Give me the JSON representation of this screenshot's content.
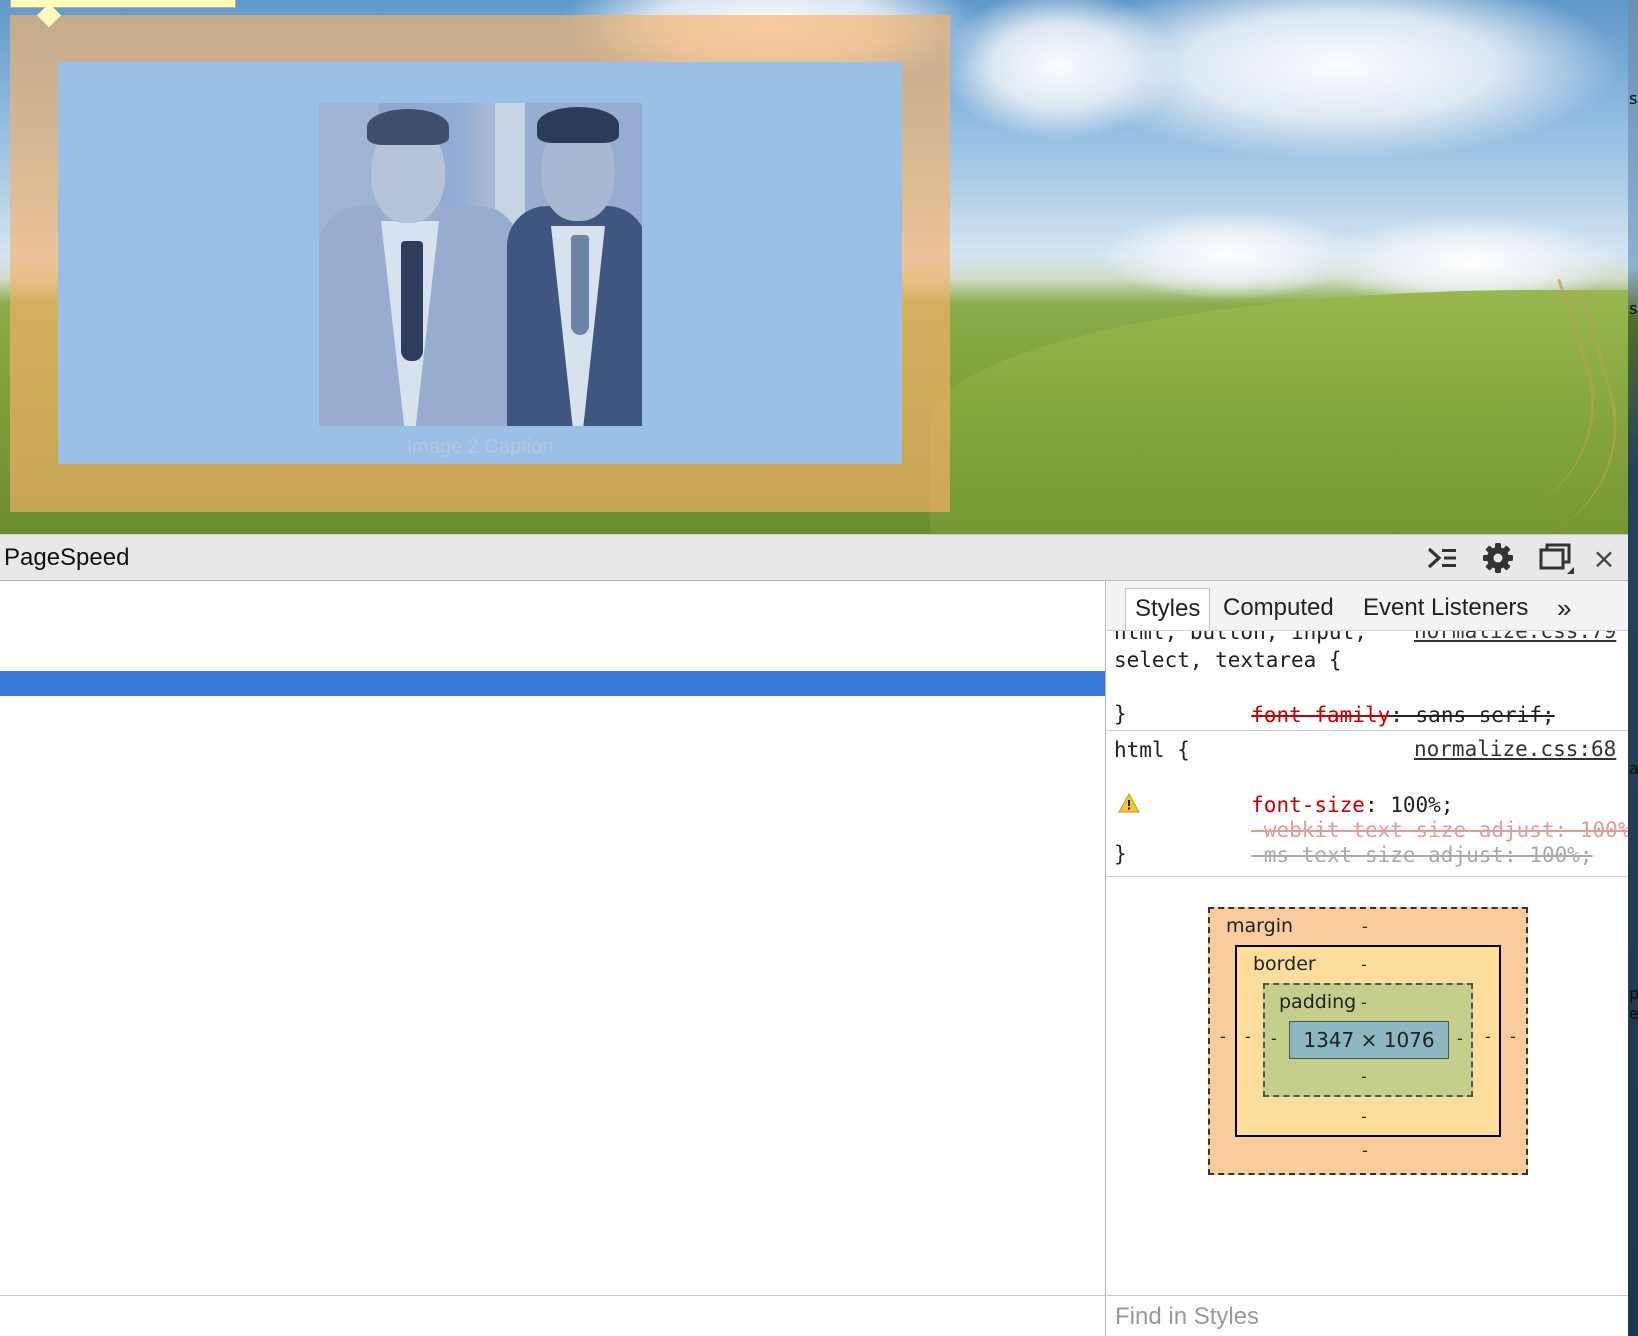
{
  "preview": {
    "caption": "Image 2 Caption"
  },
  "devtools": {
    "panel_title": "PageSpeed",
    "toolbar_icons": [
      "console-drawer-icon",
      "settings-gear-icon",
      "dock-undock-icon",
      "close-icon"
    ],
    "close_glyph": "×",
    "sidebar": {
      "tabs": [
        "Styles",
        "Computed",
        "Event Listeners"
      ],
      "more_tabs_glyph": "»",
      "rules": [
        {
          "selector_line1": "html, button, input,",
          "selector_line2": "select, textarea {",
          "source": "normalize.css:79",
          "declarations": [
            {
              "property": "font-family",
              "value": "sans-serif;"
            }
          ],
          "close": "}"
        },
        {
          "selector": "html {",
          "source": "normalize.css:68",
          "declarations": [
            {
              "property": "font-size",
              "value": "100%;"
            },
            {
              "property": "-webkit-text-size-adjust",
              "value": "100%;"
            },
            {
              "property": "-ms-text-size-adjust",
              "value": "100%;"
            }
          ],
          "close": "}"
        }
      ],
      "box_model": {
        "margin_label": "margin",
        "border_label": "border",
        "padding_label": "padding",
        "content_size": "1347 × 1076",
        "dash": "-"
      },
      "find_placeholder": "Find in Styles"
    }
  }
}
